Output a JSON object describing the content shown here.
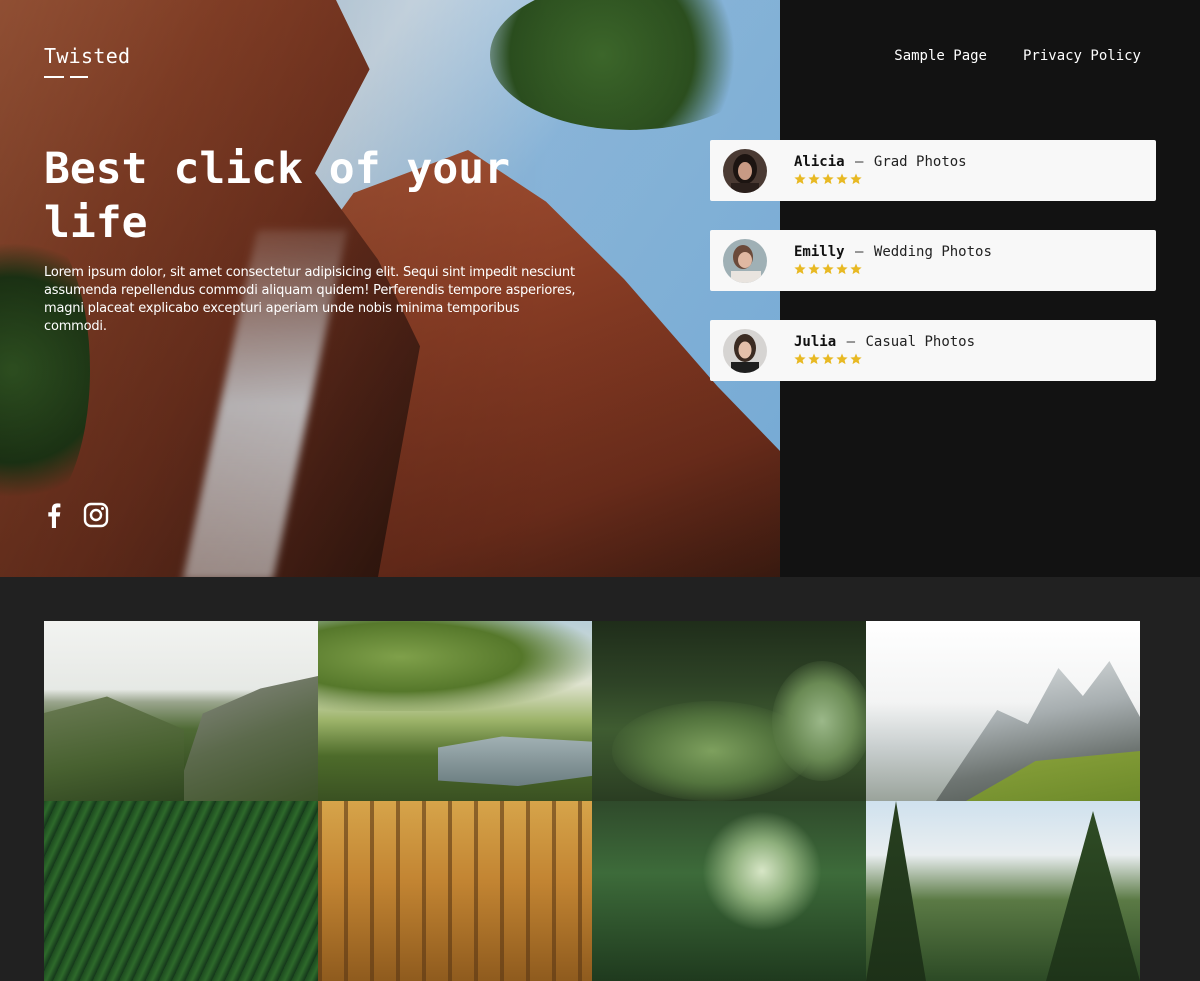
{
  "site": {
    "title": "Twisted"
  },
  "nav": {
    "items": [
      "Sample Page",
      "Privacy Policy"
    ]
  },
  "hero": {
    "headline": "Best click of your life",
    "intro": "Lorem ipsum dolor, sit amet consectetur adipisicing elit. Sequi sint impedit nesciunt assumenda repellendus commodi aliquam quidem! Perferendis tempore asperiores, magni placeat explicabo excepturi aperiam unde nobis minima temporibus commodi."
  },
  "social": [
    {
      "icon": "facebook-icon"
    },
    {
      "icon": "instagram-icon"
    }
  ],
  "reviews": [
    {
      "name": "Alicia",
      "category": "Grad Photos",
      "rating": 5
    },
    {
      "name": "Emilly",
      "category": "Wedding Photos",
      "rating": 5
    },
    {
      "name": "Julia",
      "category": "Casual Photos",
      "rating": 5
    }
  ],
  "colors": {
    "page_background": "#212121",
    "hero_panel": "#121212",
    "card_background": "#f8f8f8",
    "star": "#e8b923",
    "text_light": "#ffffff"
  },
  "separator": "—",
  "gallery": {
    "photos": [
      {
        "subject": "green canyon valley"
      },
      {
        "subject": "tree over river in morning light"
      },
      {
        "subject": "jungle palm leaves"
      },
      {
        "subject": "rocky mountain peak"
      },
      {
        "subject": "fern leaves close-up"
      },
      {
        "subject": "autumn forest"
      },
      {
        "subject": "sunlit rainforest trees"
      },
      {
        "subject": "pine forest valley"
      }
    ]
  }
}
